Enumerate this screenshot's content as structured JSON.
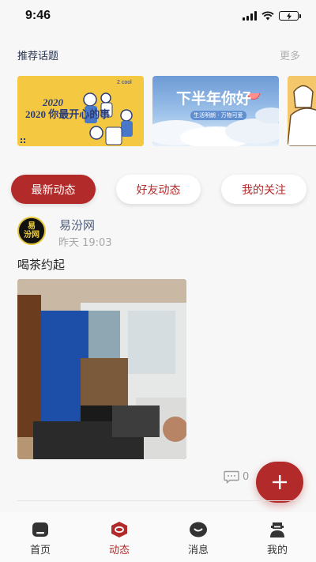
{
  "status_bar": {
    "time": "9:46",
    "icons": [
      "signal-icon",
      "wifi-icon",
      "battery-charging-icon"
    ]
  },
  "topics": {
    "title": "推荐话题",
    "more": "更多",
    "banners": [
      {
        "title": "2020 你最开心的事",
        "icon": "topic-banner-image"
      },
      {
        "title": "下半年你好",
        "subtitle": "生活明朗 · 万物可爱",
        "icon": "topic-banner-image"
      },
      {
        "icon": "topic-banner-image"
      }
    ]
  },
  "feed_tabs": [
    {
      "label": "最新动态",
      "active": true
    },
    {
      "label": "好友动态",
      "active": false
    },
    {
      "label": "我的关注",
      "active": false
    }
  ],
  "post": {
    "avatar_text_line1": "易",
    "avatar_text_line2": "汾网",
    "author": "易汾网",
    "time": "昨天 19:03",
    "text": "喝茶约起",
    "comment_count": "0"
  },
  "fab": {
    "icon": "plus-icon"
  },
  "colors": {
    "accent": "#b22a2a",
    "background": "#f7f7f7"
  },
  "tab_bar": [
    {
      "label": "首页",
      "icon": "home-icon"
    },
    {
      "label": "动态",
      "icon": "feed-icon",
      "active": true
    },
    {
      "label": "消息",
      "icon": "message-icon"
    },
    {
      "label": "我的",
      "icon": "profile-icon"
    }
  ]
}
